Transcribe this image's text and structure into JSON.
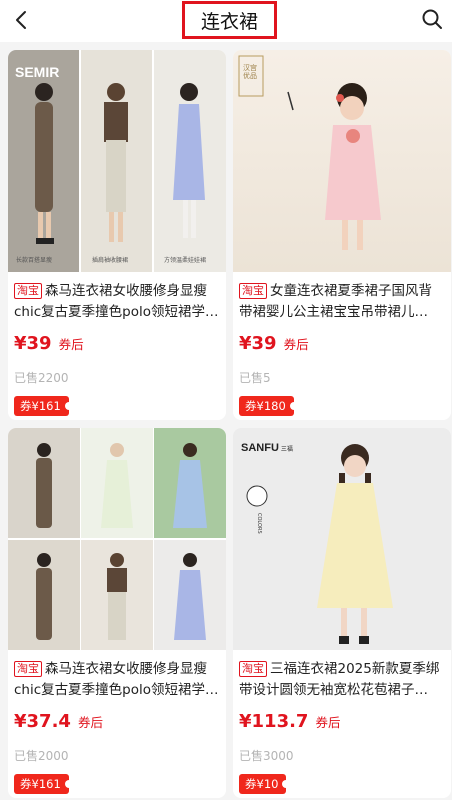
{
  "header": {
    "title": "连衣裙",
    "back_icon": "back-arrow-icon",
    "search_icon": "search-icon",
    "highlight_color": "#e0141e"
  },
  "products": [
    {
      "tag": "淘宝",
      "title": "森马连衣裙女收腰修身显瘦chic复古夏季撞色polo领短裙学…",
      "price": "¥39",
      "price_suffix": "券后",
      "sold": "已售2200",
      "coupon": "券¥161",
      "image": {
        "brand": "SEMIR",
        "captions": [
          "长款百搭显瘦",
          "插肩袖收腰裙",
          "方领温柔娃娃裙"
        ]
      }
    },
    {
      "tag": "淘宝",
      "title": "女童连衣裙夏季裙子国风背带裙婴儿公主裙宝宝吊带裙儿…",
      "price": "¥39",
      "price_suffix": "券后",
      "sold": "已售5",
      "coupon": "券¥180",
      "image": {
        "seal": "汉宫优品"
      }
    },
    {
      "tag": "淘宝",
      "title": "森马连衣裙女收腰修身显瘦chic复古夏季撞色polo领短裙学…",
      "price": "¥37.4",
      "price_suffix": "券后",
      "sold": "已售2000",
      "coupon": "券¥161",
      "image": {}
    },
    {
      "tag": "淘宝",
      "title": "三福连衣裙2025新款夏季绑带设计圆领无袖宽松花苞裙子…",
      "price": "¥113.7",
      "price_suffix": "券后",
      "sold": "已售3000",
      "coupon": "券¥10",
      "image": {
        "brand": "SANFU",
        "brand_cn": "三福",
        "badge": "COLORS"
      }
    }
  ],
  "colors": {
    "accent": "#e0141e",
    "coupon_bg": "#f0271c",
    "sold_text": "#b4b4b4",
    "page_bg": "#f4f4f4"
  }
}
